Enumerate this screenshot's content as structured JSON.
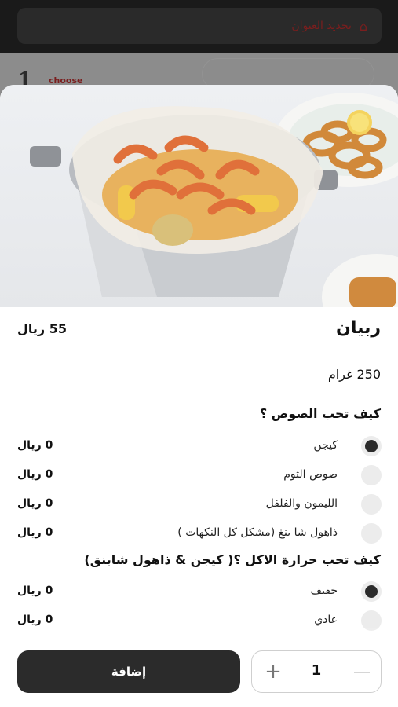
{
  "background": {
    "address_label": "تحديد العنوان",
    "step_number": "1",
    "step_label": "choose"
  },
  "product": {
    "name": "ربيان",
    "price": "55 ريال",
    "weight": "250 غرام"
  },
  "groups": [
    {
      "title": "كيف تحب الصوص ؟",
      "options": [
        {
          "label": "كيجن",
          "price": "0 ريال",
          "selected": true
        },
        {
          "label": "صوص الثوم",
          "price": "0 ريال",
          "selected": false
        },
        {
          "label": "الليمون والفلفل",
          "price": "0 ريال",
          "selected": false
        },
        {
          "label": "ذاهول شا بنغ (مشكل كل النكهات )",
          "price": "0 ريال",
          "selected": false
        }
      ]
    },
    {
      "title": "كيف تحب حرارة الاكل ؟( كيجن & ذاهول شابنق)",
      "options": [
        {
          "label": "خفيف",
          "price": "0 ريال",
          "selected": true
        },
        {
          "label": "عادي",
          "price": "0 ريال",
          "selected": false
        }
      ]
    }
  ],
  "footer": {
    "add_label": "إضافة",
    "quantity": "1"
  },
  "colors": {
    "accent_dark": "#2b2b2b",
    "radio_off": "#ececec"
  }
}
